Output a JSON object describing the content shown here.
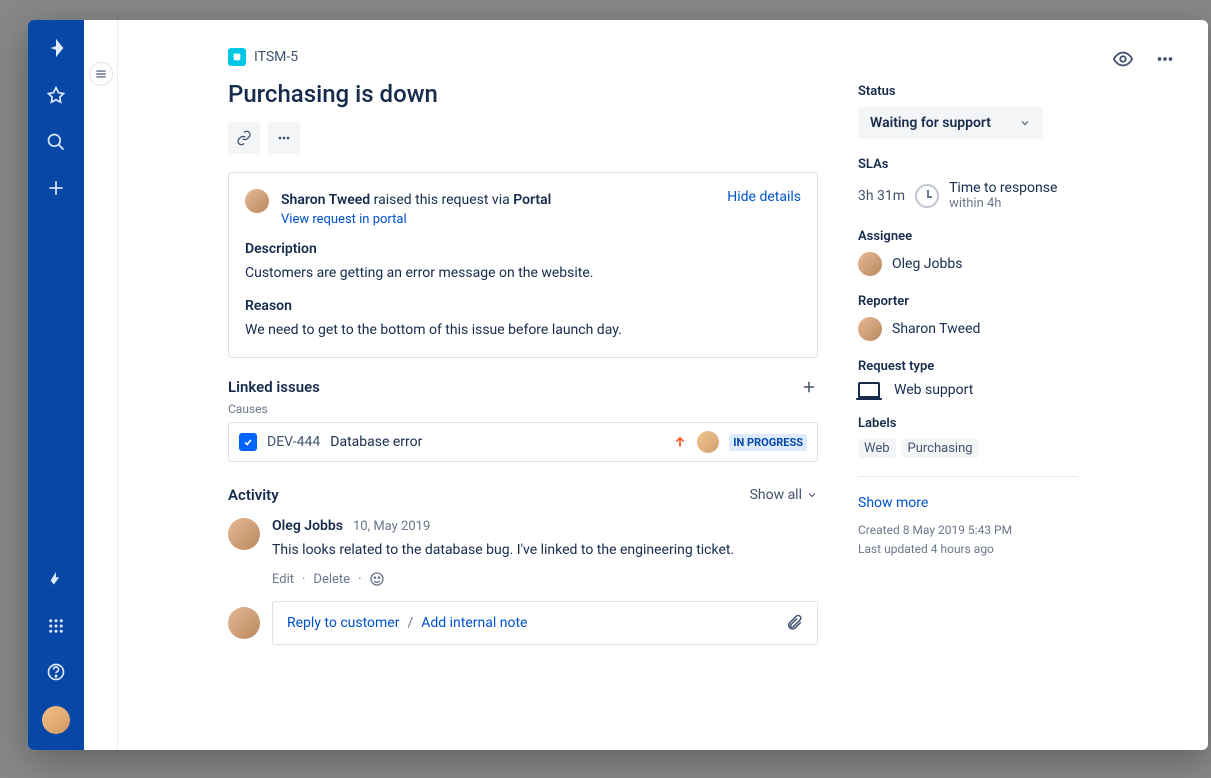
{
  "breadcrumb": {
    "issue_key": "ITSM-5"
  },
  "title": "Purchasing is down",
  "panel": {
    "reporter": "Sharon Tweed",
    "raised_text": " raised this request via ",
    "channel": "Portal",
    "hide_details": "Hide details",
    "view_in_portal": "View request in portal",
    "description_label": "Description",
    "description": "Customers are getting an error message on the website.",
    "reason_label": "Reason",
    "reason": "We need to get to the bottom of this issue before launch day."
  },
  "linked": {
    "section_title": "Linked issues",
    "relation": "Causes",
    "key": "DEV-444",
    "summary": "Database error",
    "status": "IN PROGRESS"
  },
  "activity": {
    "section_title": "Activity",
    "show_all": "Show all",
    "comment": {
      "author": "Oleg Jobbs",
      "date": "10, May 2019",
      "body": "This looks related to the database bug. I've linked to the engineering ticket.",
      "edit": "Edit",
      "delete": "Delete"
    },
    "reply_customer": "Reply to customer",
    "reply_sep": "/",
    "add_internal": "Add internal note"
  },
  "side": {
    "status_label": "Status",
    "status_value": "Waiting for support",
    "slas_label": "SLAs",
    "sla_remaining": "3h 31m",
    "sla_name": "Time to response",
    "sla_goal": "within 4h",
    "assignee_label": "Assignee",
    "assignee": "Oleg Jobbs",
    "reporter_label": "Reporter",
    "reporter": "Sharon Tweed",
    "reqtype_label": "Request type",
    "reqtype": "Web support",
    "labels_label": "Labels",
    "label1": "Web",
    "label2": "Purchasing",
    "show_more": "Show more",
    "created": "Created 8 May 2019 5:43 PM",
    "updated": "Last updated 4 hours ago"
  }
}
